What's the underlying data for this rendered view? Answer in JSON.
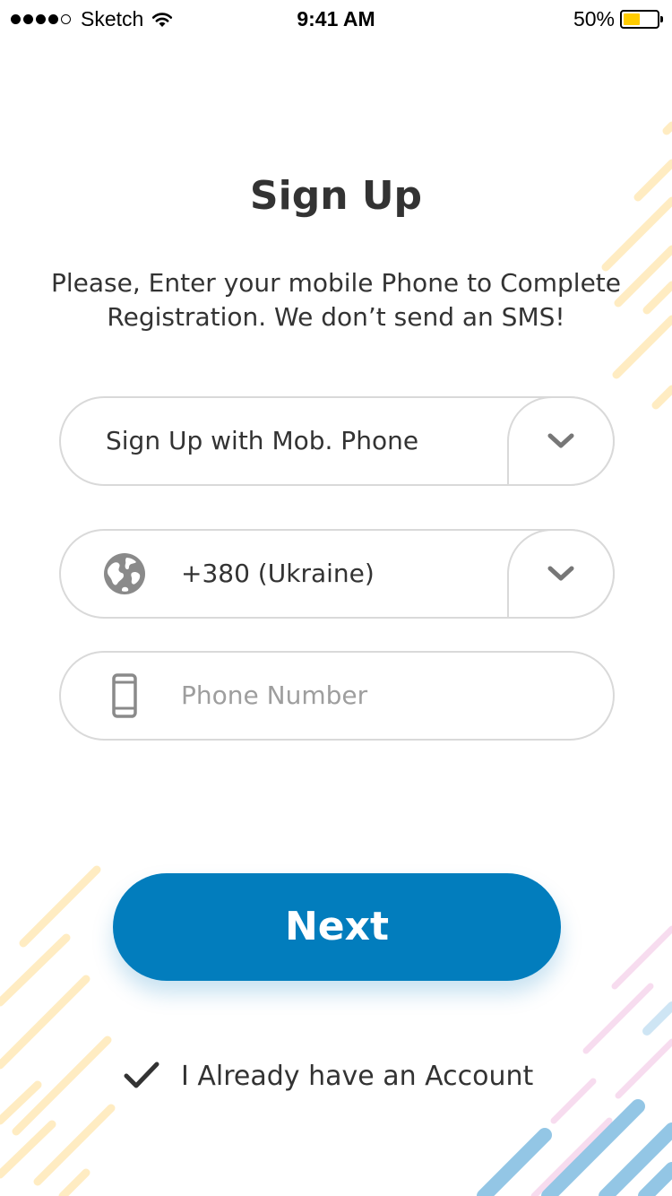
{
  "status_bar": {
    "carrier": "Sketch",
    "time": "9:41 AM",
    "battery_percent": "50%",
    "battery_level": 0.5
  },
  "title": "Sign Up",
  "subtitle_line1": "Please, Enter your mobile Phone to Complete",
  "subtitle_line2": "Registration. We don’t send an SMS!",
  "signup_method": {
    "value": "Sign Up with Mob. Phone",
    "icon": "chevron-down-icon"
  },
  "country_code": {
    "value": "+380 (Ukraine)",
    "icon": "globe-icon",
    "dropdown_icon": "chevron-down-icon"
  },
  "phone": {
    "value": "",
    "placeholder": "Phone Number",
    "icon": "mobile-phone-icon"
  },
  "next_button": {
    "label": "Next"
  },
  "account_link": {
    "label": "I Already have an Account",
    "icon": "checkmark-icon"
  },
  "colors": {
    "accent": "#027dbd",
    "battery": "#ffcc00",
    "stripe_yellow": "#ffe9b8",
    "stripe_blue": "#6fb3dd",
    "stripe_pink": "#f7d9ee"
  }
}
